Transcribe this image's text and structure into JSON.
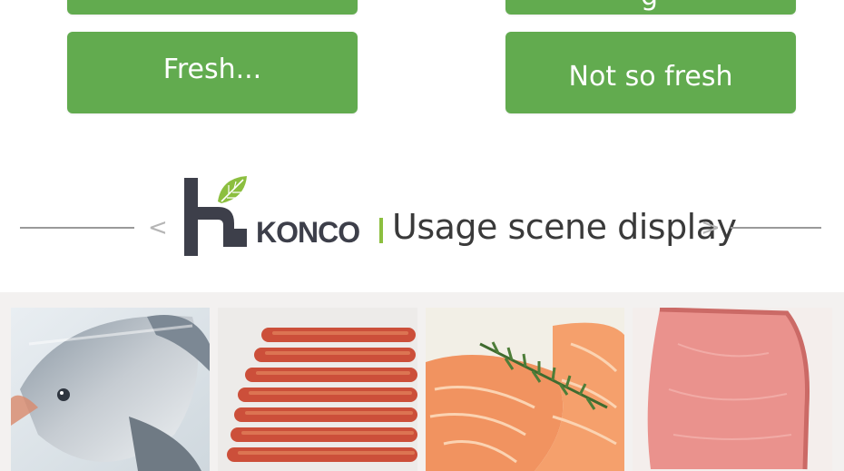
{
  "buttons": {
    "top_left_partial": "",
    "top_right_partial": "g",
    "fresh": "Fresh...",
    "not_so_fresh": "Not so fresh"
  },
  "section": {
    "brand": "KONCO",
    "title": "Usage scene display",
    "prev_glyph": "<",
    "next_glyph": ">"
  },
  "colors": {
    "button_green": "#62ab4f",
    "leaf_green": "#8cbf3f",
    "logo_dark": "#3d3f4a",
    "title_text": "#3a3a3a"
  },
  "photos": [
    {
      "name": "vacuum-sealed-fish"
    },
    {
      "name": "vacuum-sealed-sausages"
    },
    {
      "name": "vacuum-sealed-salmon"
    },
    {
      "name": "vacuum-sealed-ham"
    }
  ]
}
